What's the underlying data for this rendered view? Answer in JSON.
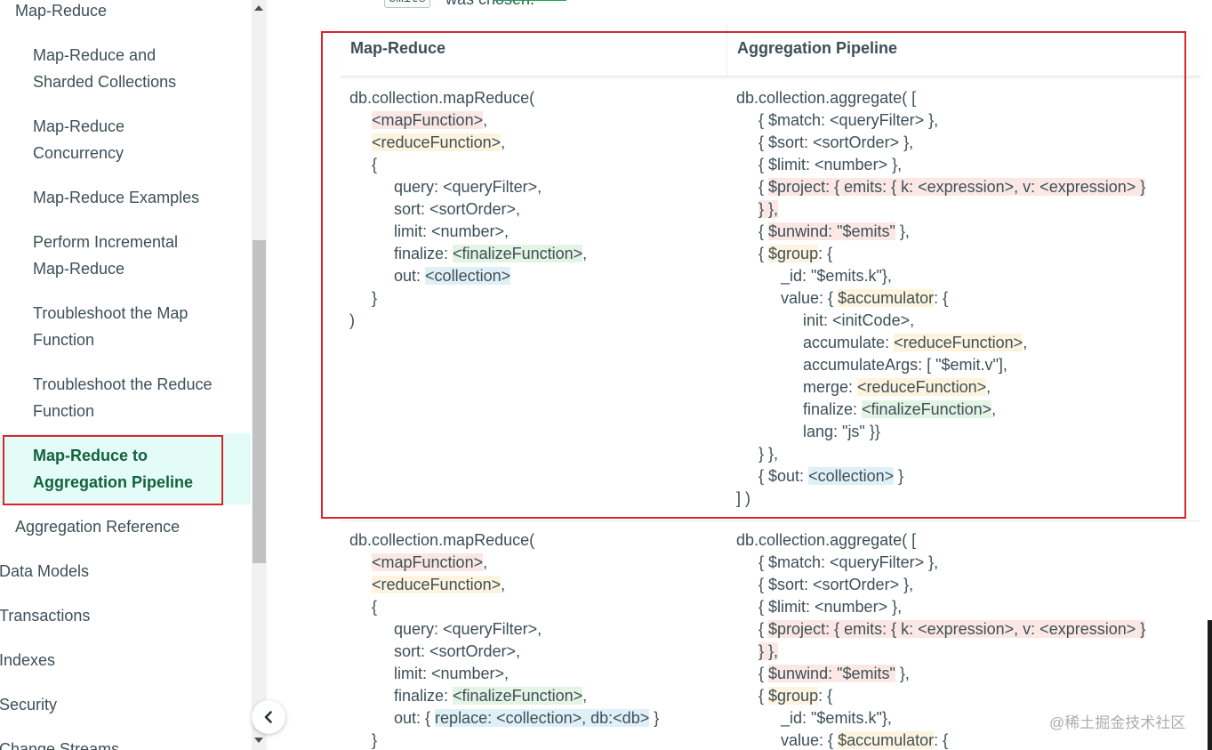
{
  "sidebar": {
    "items": [
      {
        "label": "Map-Reduce",
        "level": 1
      },
      {
        "label_lines": [
          "Map-Reduce and",
          "Sharded Collections"
        ],
        "level": 2
      },
      {
        "label_lines": [
          "Map-Reduce",
          "Concurrency"
        ],
        "level": 2
      },
      {
        "label": "Map-Reduce Examples",
        "level": 2
      },
      {
        "label_lines": [
          "Perform Incremental",
          "Map-Reduce"
        ],
        "level": 2
      },
      {
        "label_lines": [
          "Troubleshoot the Map",
          "Function"
        ],
        "level": 2
      },
      {
        "label_lines": [
          "Troubleshoot the Reduce",
          "Function"
        ],
        "level": 2
      },
      {
        "label_lines": [
          "Map-Reduce to",
          "Aggregation Pipeline"
        ],
        "level": 2,
        "active": true
      },
      {
        "label": "Aggregation Reference",
        "level": 1
      },
      {
        "label": "Data Models",
        "level": 0
      },
      {
        "label": "Transactions",
        "level": 0
      },
      {
        "label": "Indexes",
        "level": 0
      },
      {
        "label": "Security",
        "level": 0
      },
      {
        "label": "Change Streams",
        "level": 0
      }
    ],
    "collapse_icon": "chevron-left-icon"
  },
  "top_fragment": {
    "code": "emits",
    "text": "was chosen."
  },
  "table": {
    "headers": [
      "Map-Reduce",
      "Aggregation Pipeline"
    ],
    "rows": [
      {
        "left": [
          [
            {
              "t": "db.collection.mapReduce("
            }
          ],
          [
            {
              "t": "     "
            },
            {
              "t": "<mapFunction>",
              "c": "red"
            },
            {
              "t": ","
            }
          ],
          [
            {
              "t": "     "
            },
            {
              "t": "<reduceFunction>",
              "c": "yel"
            },
            {
              "t": ","
            }
          ],
          [
            {
              "t": "     {"
            }
          ],
          [
            {
              "t": "          query: <queryFilter>,"
            }
          ],
          [
            {
              "t": "          sort: <sortOrder>,"
            }
          ],
          [
            {
              "t": "          limit: <number>,"
            }
          ],
          [
            {
              "t": "          finalize: "
            },
            {
              "t": "<finalizeFunction>",
              "c": "grn"
            },
            {
              "t": ","
            }
          ],
          [
            {
              "t": "          out: "
            },
            {
              "t": "<collection>",
              "c": "blu"
            }
          ],
          [
            {
              "t": "     }"
            }
          ],
          [
            {
              "t": ")"
            }
          ]
        ],
        "right": [
          [
            {
              "t": "db.collection.aggregate( ["
            }
          ],
          [
            {
              "t": "     { $match: <queryFilter> },"
            }
          ],
          [
            {
              "t": "     { $sort: <sortOrder> },"
            }
          ],
          [
            {
              "t": "     { $limit: <number> },"
            }
          ],
          [
            {
              "t": "     { "
            },
            {
              "t": "$project: { emits: { k: <expression>, v: <expression> }",
              "c": "red"
            }
          ],
          [
            {
              "t": "     "
            },
            {
              "t": "} },",
              "c": "red"
            }
          ],
          [
            {
              "t": "     { "
            },
            {
              "t": "$unwind: \"$emits\"",
              "c": "red"
            },
            {
              "t": " },"
            }
          ],
          [
            {
              "t": "     { "
            },
            {
              "t": "$group",
              "c": "yel"
            },
            {
              "t": ": {"
            }
          ],
          [
            {
              "t": "          _id: \"$emits.k\"},"
            }
          ],
          [
            {
              "t": "          value: { "
            },
            {
              "t": "$accumulator",
              "c": "yel"
            },
            {
              "t": ": {"
            }
          ],
          [
            {
              "t": "               init: <initCode>,"
            }
          ],
          [
            {
              "t": "               accumulate: "
            },
            {
              "t": "<reduceFunction>",
              "c": "yel"
            },
            {
              "t": ","
            }
          ],
          [
            {
              "t": "               accumulateArgs: [ \"$emit.v\"],"
            }
          ],
          [
            {
              "t": "               merge: "
            },
            {
              "t": "<reduceFunction>",
              "c": "yel"
            },
            {
              "t": ","
            }
          ],
          [
            {
              "t": "               finalize: "
            },
            {
              "t": "<finalizeFunction>",
              "c": "grn"
            },
            {
              "t": ","
            }
          ],
          [
            {
              "t": "               lang: \"js\" }}"
            }
          ],
          [
            {
              "t": "     } },"
            }
          ],
          [
            {
              "t": "     { $out: "
            },
            {
              "t": "<collection>",
              "c": "blu"
            },
            {
              "t": " }"
            }
          ],
          [
            {
              "t": "] )"
            }
          ]
        ]
      },
      {
        "left": [
          [
            {
              "t": "db.collection.mapReduce("
            }
          ],
          [
            {
              "t": "     "
            },
            {
              "t": "<mapFunction>",
              "c": "red"
            },
            {
              "t": ","
            }
          ],
          [
            {
              "t": "     "
            },
            {
              "t": "<reduceFunction>",
              "c": "yel"
            },
            {
              "t": ","
            }
          ],
          [
            {
              "t": "     {"
            }
          ],
          [
            {
              "t": "          query: <queryFilter>,"
            }
          ],
          [
            {
              "t": "          sort: <sortOrder>,"
            }
          ],
          [
            {
              "t": "          limit: <number>,"
            }
          ],
          [
            {
              "t": "          finalize: "
            },
            {
              "t": "<finalizeFunction>",
              "c": "grn"
            },
            {
              "t": ","
            }
          ],
          [
            {
              "t": "          out: { "
            },
            {
              "t": "replace: <collection>, db:<db>",
              "c": "blu"
            },
            {
              "t": " }"
            }
          ],
          [
            {
              "t": "     }"
            }
          ]
        ],
        "right": [
          [
            {
              "t": "db.collection.aggregate( ["
            }
          ],
          [
            {
              "t": "     { $match: <queryFilter> },"
            }
          ],
          [
            {
              "t": "     { $sort: <sortOrder> },"
            }
          ],
          [
            {
              "t": "     { $limit: <number> },"
            }
          ],
          [
            {
              "t": "     { "
            },
            {
              "t": "$project: { emits: { k: <expression>, v: <expression> }",
              "c": "red"
            }
          ],
          [
            {
              "t": "     "
            },
            {
              "t": "} },",
              "c": "red"
            }
          ],
          [
            {
              "t": "     { "
            },
            {
              "t": "$unwind: \"$emits\"",
              "c": "red"
            },
            {
              "t": " },"
            }
          ],
          [
            {
              "t": "     { "
            },
            {
              "t": "$group",
              "c": "yel"
            },
            {
              "t": ": {"
            }
          ],
          [
            {
              "t": "          _id: \"$emits.k\"},"
            }
          ],
          [
            {
              "t": "          value: { "
            },
            {
              "t": "$accumulator",
              "c": "yel"
            },
            {
              "t": ": {"
            }
          ]
        ]
      }
    ]
  },
  "watermark": "@稀土掘金技术社区",
  "colors": {
    "highlight_box": "#d9262c",
    "active_nav_bg": "#e3fcf7",
    "active_nav_text": "#13613d"
  }
}
